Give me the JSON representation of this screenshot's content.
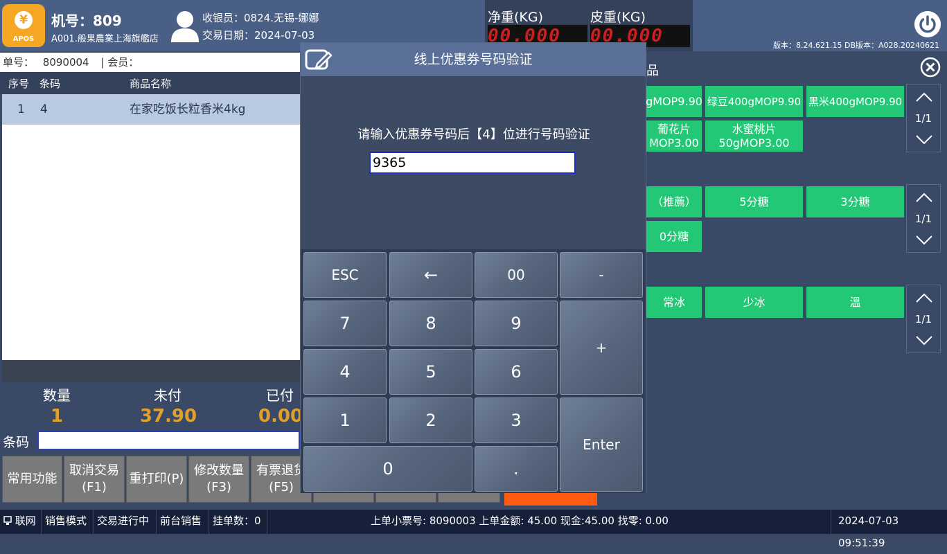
{
  "header": {
    "logo_text": "APOS",
    "logo_glyph": "¥",
    "machine_no": "机号：809",
    "store_name": "A001.般果農業上海旗艦店",
    "cashier": "收银员：0824.无锡-娜娜",
    "trade_date": "交易日期：2024-07-03",
    "net_weight_label": "净重(KG)",
    "tare_weight_label": "皮重(KG)",
    "net_weight_display": "00.000",
    "tare_weight_display": "00.000",
    "version": "版本：8.24.621.15 DB版本：A028.20240621"
  },
  "ticket": {
    "ticket_no_label": "单号：",
    "ticket_no": "8090004",
    "member_label": "| 会员："
  },
  "grid": {
    "columns": [
      "序号",
      "条码",
      "商品名称"
    ],
    "rows": [
      {
        "seq": "1",
        "code": "4",
        "name": "在家吃饭长粒香米4kg"
      }
    ]
  },
  "summary": {
    "qty_label": "数量",
    "qty": "1",
    "unpaid_label": "未付",
    "unpaid": "37.90",
    "paid_label": "已付",
    "paid": "0.00"
  },
  "barcode": {
    "label": "条码",
    "value": ""
  },
  "function_keys": [
    {
      "label": "常用功能",
      "key": ""
    },
    {
      "label": "取消交易",
      "key": "(F1)"
    },
    {
      "label": "重打印(P)",
      "key": ""
    },
    {
      "label": "修改数量",
      "key": "(F3)"
    },
    {
      "label": "有票退货",
      "key": "(F5)"
    }
  ],
  "right_panel": {
    "section_title_partial": "品",
    "group1": {
      "items": [
        "gMOP9.90",
        "绿豆400gMOP9.90",
        "黑米400gMOP9.90",
        "葡花片\nMOP3.00",
        "水蜜桃片\n50gMOP3.00"
      ],
      "page": "1/1"
    },
    "group2": {
      "items": [
        "（推薦）",
        "5分糖",
        "3分糖",
        "0分糖"
      ],
      "page": "1/1"
    },
    "group3": {
      "items": [
        "常冰",
        "少冰",
        "溫"
      ],
      "page": "1/1"
    }
  },
  "modal": {
    "title": "线上优惠券号码验证",
    "prompt": "请输入优惠券号码后【4】位进行号码验证",
    "input_value": "9365",
    "keys": {
      "esc": "ESC",
      "back": "←",
      "double_zero": "00",
      "minus": "-",
      "k7": "7",
      "k8": "8",
      "k9": "9",
      "plus": "+",
      "k4": "4",
      "k5": "5",
      "k6": "6",
      "k1": "1",
      "k2": "2",
      "k3": "3",
      "enter": "Enter",
      "k0": "0",
      "dot": "."
    }
  },
  "status_bar": {
    "network": "联网",
    "mode": "销售模式",
    "state": "交易进行中",
    "sale_type": "前台销售",
    "hold_count": "挂单数：0",
    "last_ticket": "上单小票号: 8090003 上单金额: 45.00  现金:45.00 找零: 0.00",
    "datetime": "2024-07-03 09:51:39"
  },
  "colors": {
    "header_bg": "#4a5f85",
    "accent_orange": "#f5a623",
    "amount_color": "#e0a030",
    "button_green": "#22c875",
    "led_red": "#d01e1e",
    "status_bg": "#17203a"
  }
}
